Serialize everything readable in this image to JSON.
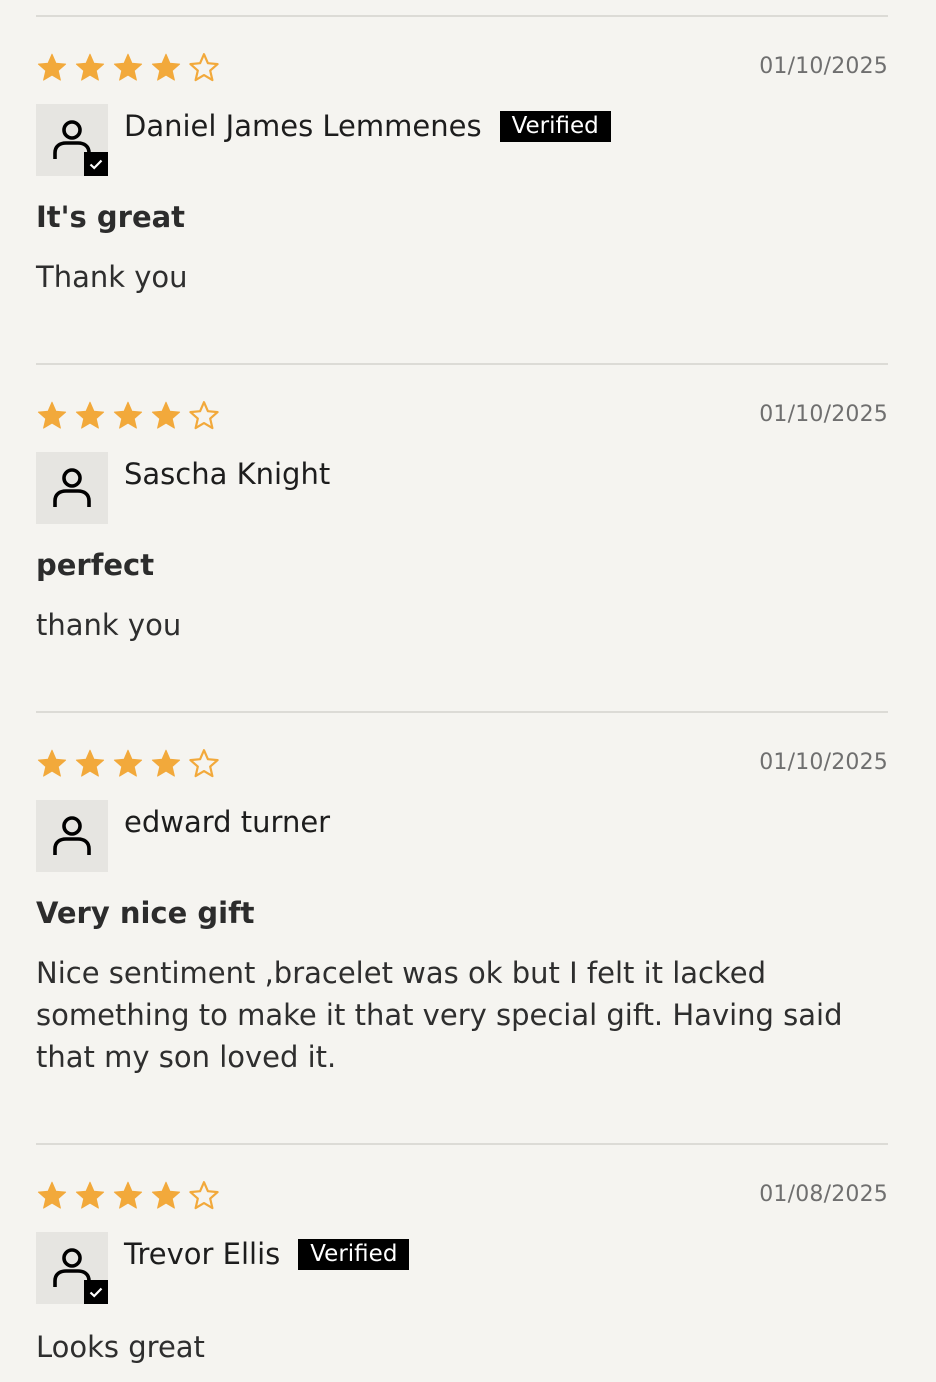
{
  "colors": {
    "star_filled": "#f2a93b",
    "star_outline": "#f2a93b",
    "badge_bg": "#000000",
    "divider": "#dcdbd6"
  },
  "icons": {
    "star": "star-icon",
    "star_empty": "star-outline-icon",
    "avatar": "user-icon",
    "verified": "checkmark-icon"
  },
  "reviews": [
    {
      "rating": 4,
      "max_rating": 5,
      "date": "01/10/2025",
      "author": "Daniel James Lemmenes",
      "verified": true,
      "verified_label": "Verified",
      "title": "It's great",
      "body": "Thank you"
    },
    {
      "rating": 4,
      "max_rating": 5,
      "date": "01/10/2025",
      "author": "Sascha Knight",
      "verified": false,
      "title": "perfect",
      "body": "thank you"
    },
    {
      "rating": 4,
      "max_rating": 5,
      "date": "01/10/2025",
      "author": "edward turner",
      "verified": false,
      "title": "Very nice gift",
      "body": "Nice sentiment ,bracelet was ok but I felt it lacked something to make it that very special gift. Having said that my son loved it."
    },
    {
      "rating": 4,
      "max_rating": 5,
      "date": "01/08/2025",
      "author": "Trevor Ellis",
      "verified": true,
      "verified_label": "Verified",
      "title": "",
      "body": "Looks great"
    }
  ]
}
